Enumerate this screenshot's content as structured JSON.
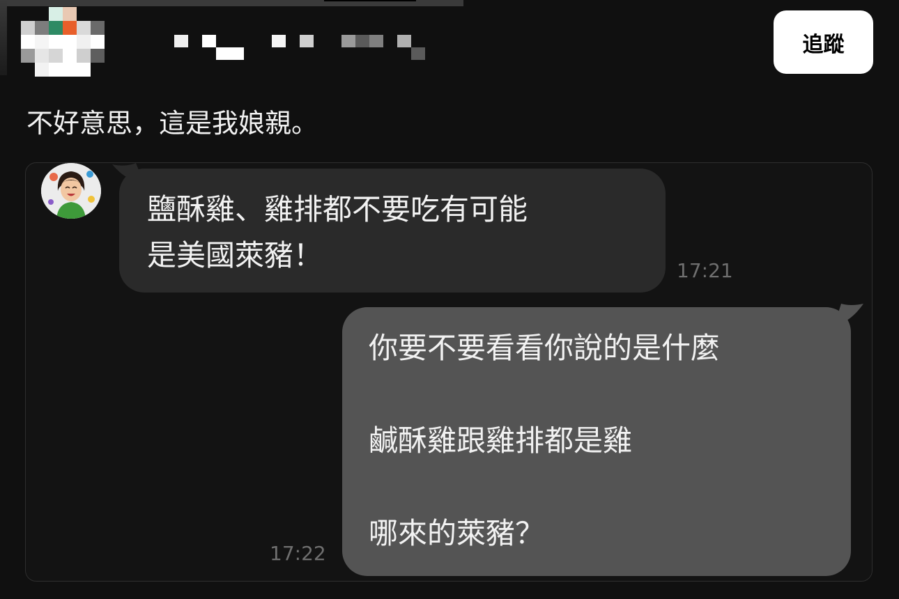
{
  "header": {
    "follow_label": "追蹤"
  },
  "post": {
    "text": "不好意思，這是我娘親。"
  },
  "chat": {
    "incoming": {
      "lines": [
        "鹽酥雞、雞排都不要吃有可能",
        "是美國萊豬！"
      ],
      "time": "17:21"
    },
    "outgoing": {
      "lines": [
        "你要不要看看你說的是什麼",
        "鹹酥雞跟雞排都是雞",
        "哪來的萊豬？"
      ],
      "time": "17:22"
    }
  },
  "colors": {
    "background": "#101010",
    "incoming_bubble": "#2a2a2a",
    "outgoing_bubble": "#545454",
    "follow_button": "#ffffff",
    "timestamp": "#6f6f6f"
  }
}
